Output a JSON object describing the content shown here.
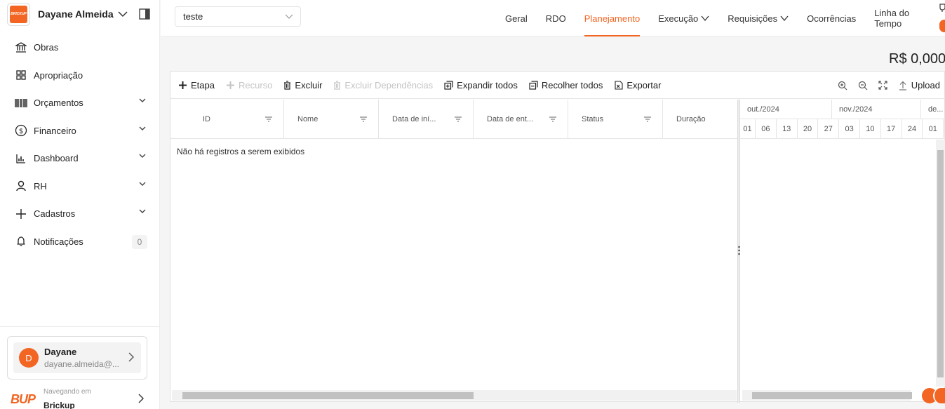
{
  "sidebar": {
    "logo_text": "BRICKUP",
    "user_name": "Dayane Almeida",
    "items": [
      {
        "label": "Obras",
        "icon": "bank-icon"
      },
      {
        "label": "Apropriação",
        "icon": "grid-icon"
      },
      {
        "label": "Orçamentos",
        "icon": "barcode-icon"
      },
      {
        "label": "Financeiro",
        "icon": "dollar-icon"
      },
      {
        "label": "Dashboard",
        "icon": "bar-chart-icon"
      },
      {
        "label": "RH",
        "icon": "person-icon"
      },
      {
        "label": "Cadastros",
        "icon": "plus-icon"
      },
      {
        "label": "Notificações",
        "icon": "bell-icon",
        "badge": "0"
      }
    ],
    "profile": {
      "initial": "D",
      "name": "Dayane",
      "email": "dayane.almeida@..."
    },
    "org": {
      "logo": "BUP",
      "label": "Navegando em",
      "name": "Brickup"
    }
  },
  "topbar": {
    "project": "teste",
    "tabs": [
      {
        "label": "Geral"
      },
      {
        "label": "RDO"
      },
      {
        "label": "Planejamento",
        "active": true
      },
      {
        "label": "Execução"
      },
      {
        "label": "Requisições"
      },
      {
        "label": "Ocorrências"
      },
      {
        "label": "Linha do Tempo"
      }
    ]
  },
  "total": "R$ 0,000",
  "toolbar": {
    "etapa": "Etapa",
    "recurso": "Recurso",
    "excluir": "Excluir",
    "excluir_dependencias": "Excluir Dependências",
    "expandir": "Expandir todos",
    "recolher": "Recolher todos",
    "exportar": "Exportar",
    "upload": "Upload"
  },
  "grid": {
    "columns": [
      "ID",
      "Nome",
      "Data de iní...",
      "Data de ent...",
      "Status",
      "Duração"
    ],
    "empty": "Não há registros a serem exibidos"
  },
  "timeline": {
    "months": [
      "out./2024",
      "nov./2024",
      "de..."
    ],
    "days": [
      "01",
      "06",
      "13",
      "20",
      "27",
      "03",
      "10",
      "17",
      "24",
      "01"
    ]
  },
  "colors": {
    "accent": "#f26522"
  }
}
